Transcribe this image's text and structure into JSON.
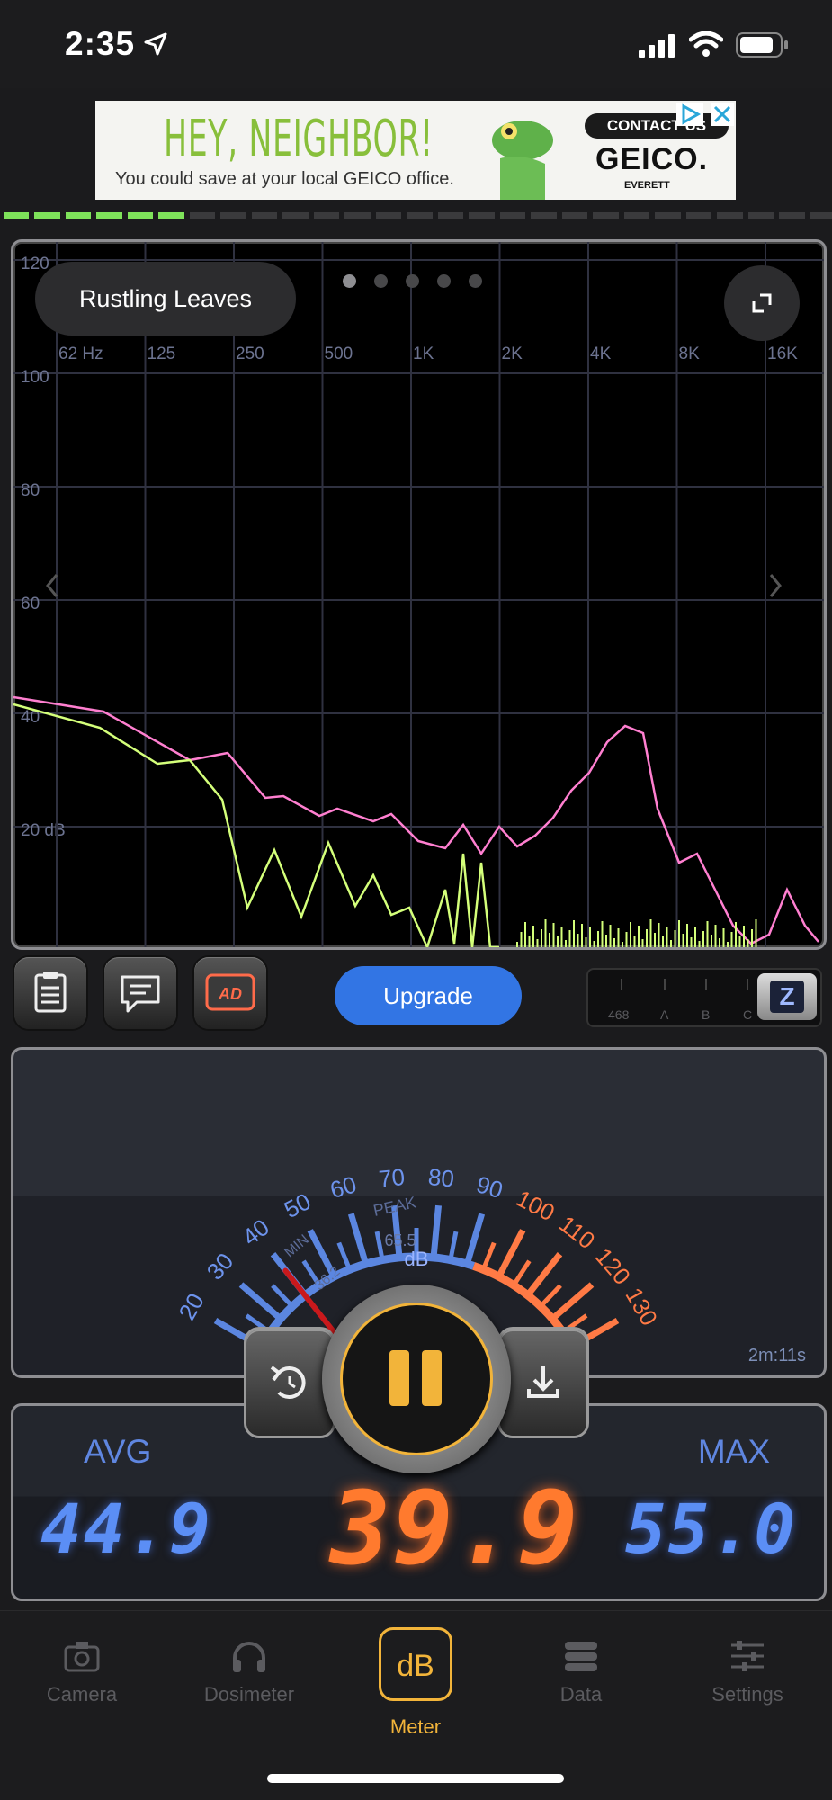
{
  "status": {
    "time": "2:35"
  },
  "ad": {
    "headline": "HEY, NEIGHBOR!",
    "subtext": "You could save at your local GEICO office.",
    "button": "CONTACT US",
    "brand": "GEICO.",
    "location": "EVERETT"
  },
  "spectrum": {
    "preset": "Rustling Leaves",
    "y_labels": [
      "120",
      "100",
      "80",
      "60",
      "40",
      "20 dB"
    ],
    "x_labels": [
      "62 Hz",
      "125",
      "250",
      "500",
      "1K",
      "2K",
      "4K",
      "8K",
      "16K"
    ],
    "page_count": 5,
    "active_page": 0
  },
  "toolbar": {
    "upgrade": "Upgrade",
    "weighting_labels": [
      "468",
      "A",
      "B",
      "C"
    ],
    "weighting_selected": "Z"
  },
  "gauge": {
    "scale": [
      "20",
      "30",
      "40",
      "50",
      "60",
      "70",
      "80",
      "90",
      "100",
      "110",
      "120",
      "130"
    ],
    "peak_label": "PEAK",
    "peak_value": "65.5",
    "min_label": "MIN",
    "min_value": "36.2",
    "unit": "dB",
    "elapsed": "2m:11s",
    "needle_value": 39.9
  },
  "readout": {
    "avg_label": "AVG",
    "avg_value": "44.9",
    "current_value": "39.9",
    "max_label": "MAX",
    "max_value": "55.0"
  },
  "tabs": [
    {
      "label": "Camera",
      "icon": "camera-icon"
    },
    {
      "label": "Dosimeter",
      "icon": "headphones-icon"
    },
    {
      "label": "Meter",
      "icon": "db-icon",
      "badge": "dB"
    },
    {
      "label": "Data",
      "icon": "database-icon"
    },
    {
      "label": "Settings",
      "icon": "sliders-icon"
    }
  ],
  "level_bar_active_segments": 6,
  "colors": {
    "accent": "#f2b43a",
    "upgrade": "#3275e4",
    "peak_trace": "#ff7fd0",
    "live_trace": "#d4ff7a"
  }
}
